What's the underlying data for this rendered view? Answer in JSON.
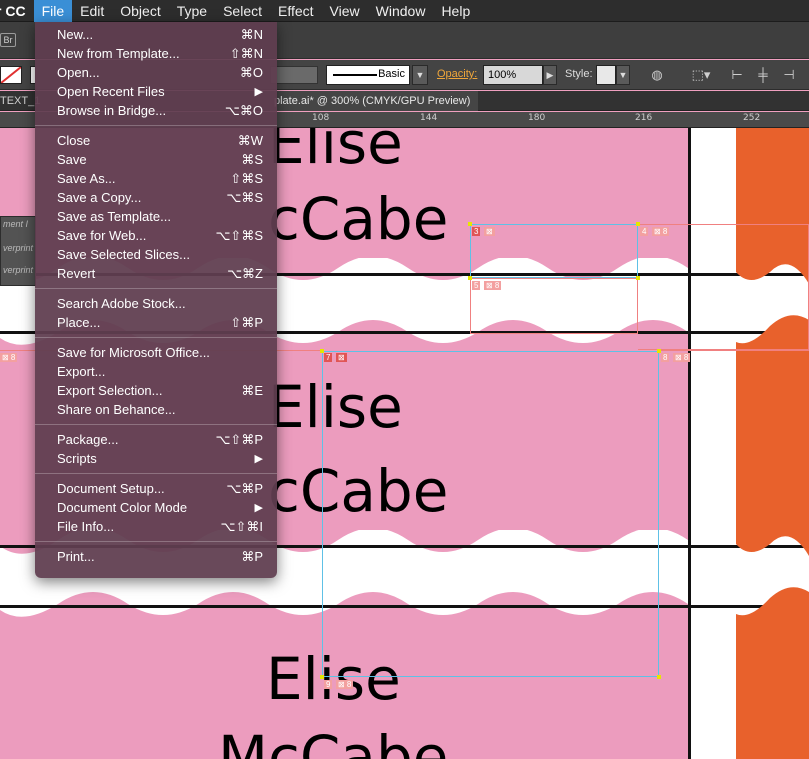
{
  "menubar": {
    "app": "r CC",
    "items": [
      "File",
      "Edit",
      "Object",
      "Type",
      "Select",
      "Effect",
      "View",
      "Window",
      "Help"
    ],
    "active": "File"
  },
  "toolbar": {
    "bridge_badge": "Br"
  },
  "control": {
    "stroke_style": "Basic",
    "opacity_label": "Opacity:",
    "opacity_value": "100%",
    "style_label": "Style:"
  },
  "tabbar": {
    "left_tab": "TEXT_1",
    "doc_tab": "plate.ai* @ 300% (CMYK/GPU Preview)"
  },
  "ruler": {
    "ticks": [
      "108",
      "144",
      "180",
      "216",
      "252"
    ]
  },
  "panel_stub": {
    "line1": "ment I",
    "line2": "verprint",
    "line3": "verprint"
  },
  "artboard": {
    "texts": [
      "Elise",
      "cCabe",
      "Elise",
      "cCabe",
      "Elise",
      "McCabe"
    ],
    "frame_tags": [
      "3",
      "4",
      "5",
      "7",
      "8",
      "9"
    ]
  },
  "file_menu": {
    "groups": [
      [
        {
          "label": "New...",
          "shortcut": "⌘N"
        },
        {
          "label": "New from Template...",
          "shortcut": "⇧⌘N"
        },
        {
          "label": "Open...",
          "shortcut": "⌘O"
        },
        {
          "label": "Open Recent Files",
          "shortcut": "",
          "submenu": true
        },
        {
          "label": "Browse in Bridge...",
          "shortcut": "⌥⌘O"
        }
      ],
      [
        {
          "label": "Close",
          "shortcut": "⌘W"
        },
        {
          "label": "Save",
          "shortcut": "⌘S"
        },
        {
          "label": "Save As...",
          "shortcut": "⇧⌘S"
        },
        {
          "label": "Save a Copy...",
          "shortcut": "⌥⌘S"
        },
        {
          "label": "Save as Template...",
          "shortcut": ""
        },
        {
          "label": "Save for Web...",
          "shortcut": "⌥⇧⌘S"
        },
        {
          "label": "Save Selected Slices...",
          "shortcut": ""
        },
        {
          "label": "Revert",
          "shortcut": "⌥⌘Z"
        }
      ],
      [
        {
          "label": "Search Adobe Stock...",
          "shortcut": ""
        },
        {
          "label": "Place...",
          "shortcut": "⇧⌘P"
        }
      ],
      [
        {
          "label": "Save for Microsoft Office...",
          "shortcut": ""
        },
        {
          "label": "Export...",
          "shortcut": ""
        },
        {
          "label": "Export Selection...",
          "shortcut": "⌘E"
        },
        {
          "label": "Share on Behance...",
          "shortcut": ""
        }
      ],
      [
        {
          "label": "Package...",
          "shortcut": "⌥⇧⌘P"
        },
        {
          "label": "Scripts",
          "shortcut": "",
          "submenu": true
        }
      ],
      [
        {
          "label": "Document Setup...",
          "shortcut": "⌥⌘P"
        },
        {
          "label": "Document Color Mode",
          "shortcut": "",
          "submenu": true
        },
        {
          "label": "File Info...",
          "shortcut": "⌥⇧⌘I"
        }
      ],
      [
        {
          "label": "Print...",
          "shortcut": "⌘P"
        }
      ]
    ]
  },
  "colors": {
    "pink": "#ec9cbe",
    "orange": "#e8612c",
    "menu_highlight": "#3a8fd6",
    "frame_blue": "#5ec1e6"
  }
}
